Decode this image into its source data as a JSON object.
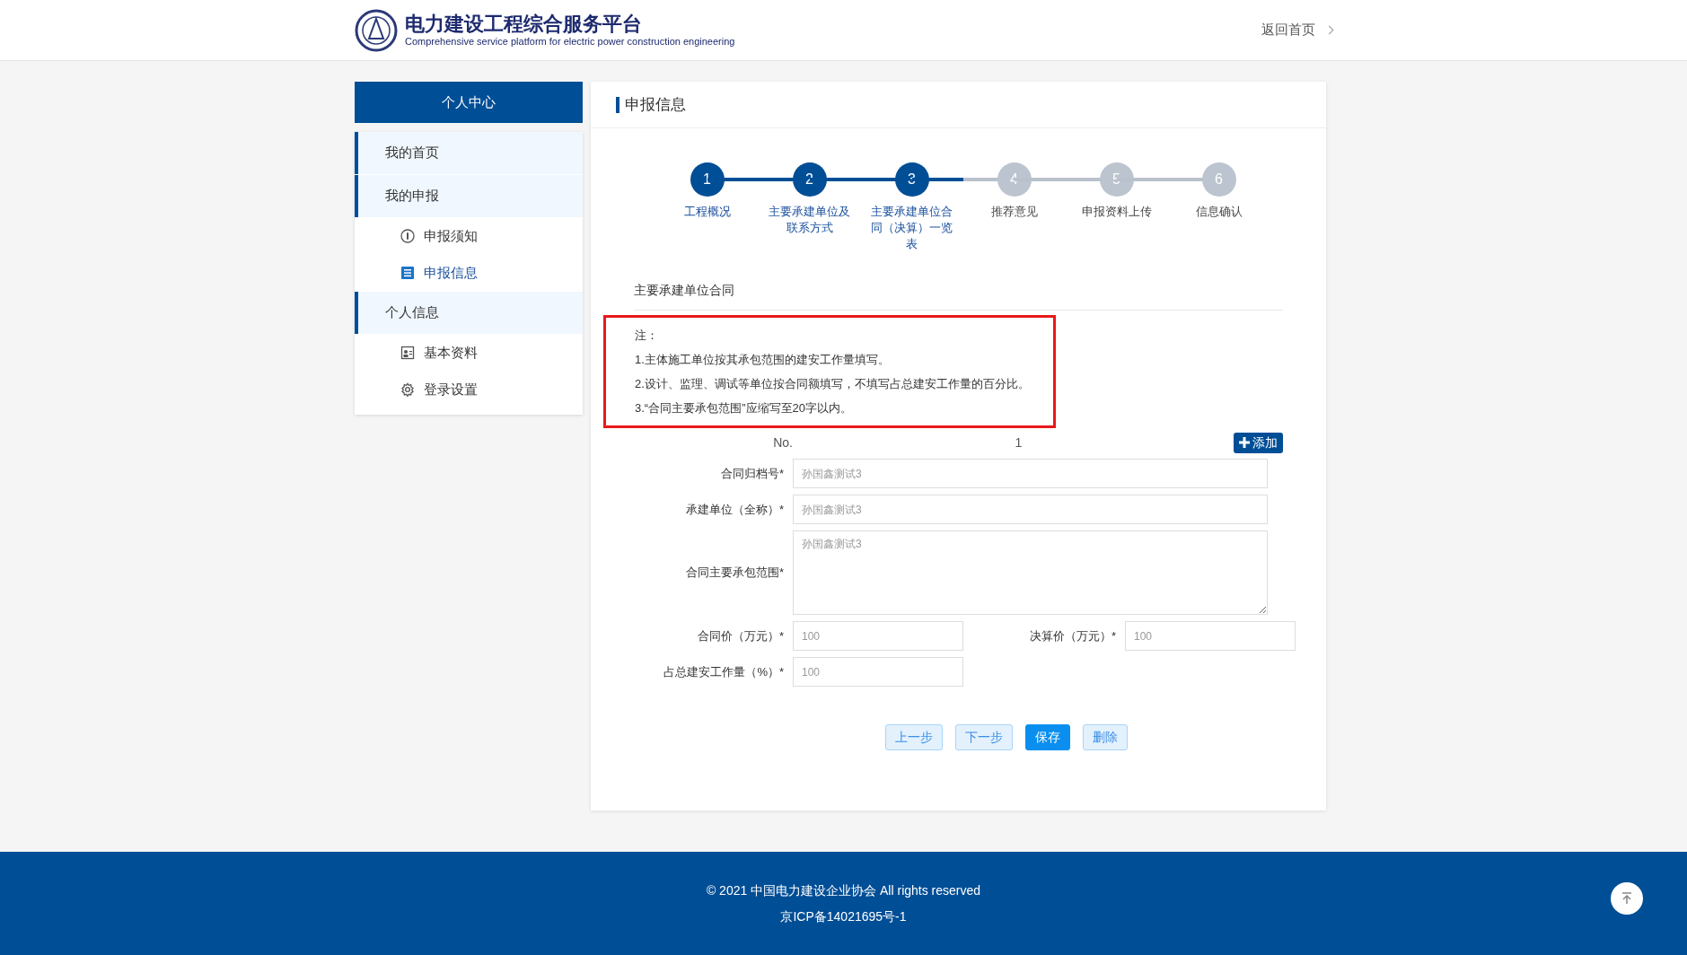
{
  "header": {
    "title": "电力建设工程综合服务平台",
    "subtitle": "Comprehensive service platform for electric power construction engineering",
    "back_link": "返回首页"
  },
  "sidebar": {
    "title": "个人中心",
    "items": [
      {
        "kind": "section",
        "label": "我的首页",
        "selected": false
      },
      {
        "kind": "section",
        "label": "我的申报",
        "selected": false
      },
      {
        "kind": "sub",
        "label": "申报须知",
        "selected": false
      },
      {
        "kind": "sub",
        "label": "申报信息",
        "selected": true
      },
      {
        "kind": "section",
        "label": "个人信息",
        "selected": false
      },
      {
        "kind": "sub",
        "label": "基本资料",
        "selected": false
      },
      {
        "kind": "sub",
        "label": "登录设置",
        "selected": false
      }
    ]
  },
  "main": {
    "title": "申报信息",
    "steps": [
      {
        "number": "1",
        "label": "工程概况",
        "done": true
      },
      {
        "number": "2",
        "label": "主要承建单位及联系方式",
        "done": true
      },
      {
        "number": "3",
        "label": "主要承建单位合同（决算）一览表",
        "done": true
      },
      {
        "number": "4",
        "label": "推荐意见",
        "done": false
      },
      {
        "number": "5",
        "label": "申报资料上传",
        "done": false
      },
      {
        "number": "6",
        "label": "信息确认",
        "done": false
      }
    ],
    "section_title": "主要承建单位合同",
    "notes": [
      "注：",
      "1.主体施工单位按其承包范围的建安工作量填写。",
      "2.设计、监理、调试等单位按合同额填写，不填写占总建安工作量的百分比。",
      "3.“合同主要承包范围”应缩写至20字以内。"
    ],
    "record": {
      "no_label": "No.",
      "no_value": "1",
      "add_button": "添加"
    },
    "rows": [
      [
        {
          "kind": "input",
          "label": "合同归档号*",
          "placeholder": "孙国鑫测试3"
        }
      ],
      [
        {
          "kind": "input",
          "label": "承建单位（全称）*",
          "placeholder": "孙国鑫测试3"
        }
      ],
      [
        {
          "kind": "textarea",
          "label": "合同主要承包范围*",
          "placeholder": "孙国鑫测试3"
        }
      ],
      [
        {
          "kind": "input",
          "label": "合同价（万元）*",
          "placeholder": "100"
        },
        {
          "kind": "input",
          "label": "决算价（万元）*",
          "placeholder": "100"
        }
      ],
      [
        {
          "kind": "short",
          "label": "占总建安工作量（%）*",
          "placeholder": "100"
        }
      ]
    ],
    "buttons": [
      {
        "label": "上一步",
        "primary": false
      },
      {
        "label": "下一步",
        "primary": false
      },
      {
        "label": "保存",
        "primary": true
      },
      {
        "label": "删除",
        "primary": false
      }
    ]
  },
  "footer": {
    "copyright": "© 2021 中国电力建设企业协会 All rights reserved",
    "icp": "京ICP备14021695号-1"
  }
}
